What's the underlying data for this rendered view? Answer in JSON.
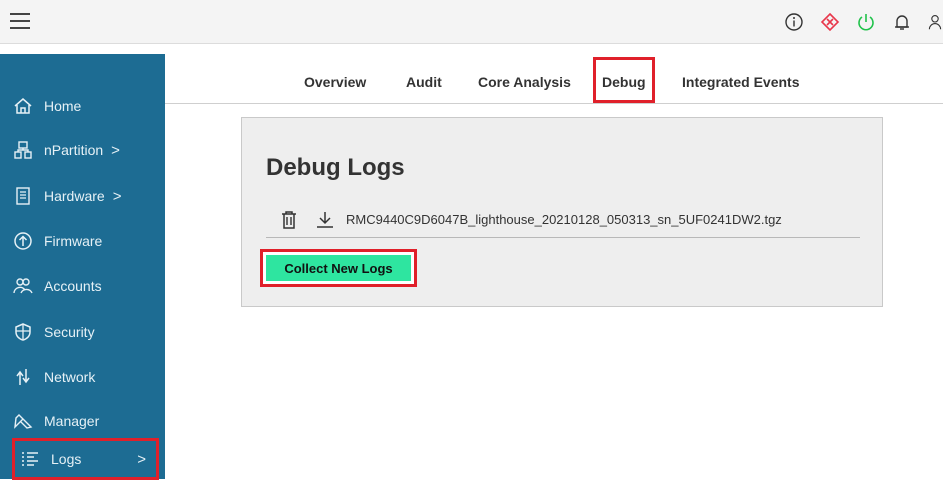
{
  "topbar": {
    "icons": [
      "info-icon",
      "alert-icon",
      "power-icon",
      "bell-icon",
      "user-icon"
    ],
    "colors": {
      "alert": "#e8364a",
      "power": "#1fc24a"
    }
  },
  "sidebar": {
    "items": [
      {
        "label": "Home",
        "icon": "home-icon",
        "chevron": ""
      },
      {
        "label": "nPartition",
        "icon": "partition-icon",
        "chevron": ">"
      },
      {
        "label": "Hardware",
        "icon": "hardware-icon",
        "chevron": ">"
      },
      {
        "label": "Firmware",
        "icon": "firmware-icon",
        "chevron": ""
      },
      {
        "label": "Accounts",
        "icon": "accounts-icon",
        "chevron": ""
      },
      {
        "label": "Security",
        "icon": "shield-icon",
        "chevron": ""
      },
      {
        "label": "Network",
        "icon": "network-icon",
        "chevron": ""
      },
      {
        "label": "Manager",
        "icon": "manager-icon",
        "chevron": ""
      },
      {
        "label": "Logs",
        "icon": "logs-icon",
        "chevron": ">"
      }
    ]
  },
  "tabs": [
    {
      "label": "Overview"
    },
    {
      "label": "Audit"
    },
    {
      "label": "Core Analysis"
    },
    {
      "label": "Debug"
    },
    {
      "label": "Integrated Events"
    }
  ],
  "main": {
    "title": "Debug Logs",
    "file_name": "RMC9440C9D6047B_lighthouse_20210128_050313_sn_5UF0241DW2.tgz",
    "collect_label": "Collect New Logs",
    "accent": "#2ee5a0",
    "highlight": "#e0202a"
  }
}
